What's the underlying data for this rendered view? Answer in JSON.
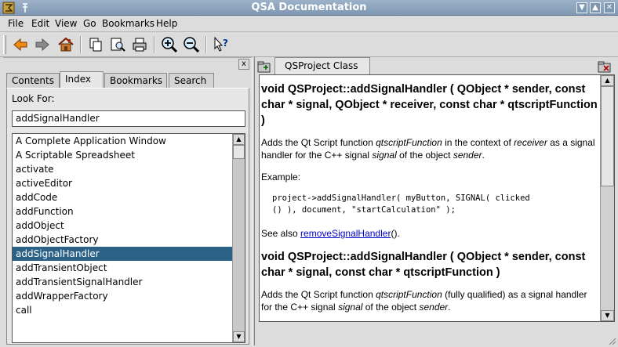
{
  "window": {
    "title": "QSA Documentation"
  },
  "menu": {
    "items": [
      "File",
      "Edit",
      "View",
      "Go",
      "Bookmarks",
      "Help"
    ]
  },
  "toolbar": {
    "buttons": [
      "back-icon",
      "forward-icon",
      "home-icon",
      "copy-icon",
      "find-icon",
      "print-icon",
      "zoom-in-icon",
      "zoom-out-icon",
      "whats-this-icon"
    ]
  },
  "sidebar": {
    "tabs": [
      "Contents",
      "Index",
      "Bookmarks",
      "Search"
    ],
    "active_tab": "Index",
    "look_for_label": "Look For:",
    "search_value": "addSignalHandler",
    "items": [
      "A Complete Application Window",
      "A Scriptable Spreadsheet",
      "activate",
      "activeEditor",
      "addCode",
      "addFunction",
      "addObject",
      "addObjectFactory",
      "addSignalHandler",
      "addTransientObject",
      "addTransientSignalHandler",
      "addWrapperFactory",
      "call"
    ],
    "selected_index": 8,
    "close_label": "x"
  },
  "document": {
    "tab_label": "QSProject Class",
    "heading1": "void QSProject::addSignalHandler ( QObject * sender, const char * signal, QObject * receiver, const char * qtscriptFunction )",
    "para1_a": "Adds the Qt Script function ",
    "para1_em1": "qtscriptFunction",
    "para1_b": " in the context of ",
    "para1_em2": "receiver",
    "para1_c": " as a signal handler for the C++ signal ",
    "para1_em3": "signal",
    "para1_d": " of the object ",
    "para1_em4": "sender",
    "para1_e": ".",
    "example_label": "Example:",
    "code": "project->addSignalHandler( myButton, SIGNAL( clicked\n() ), document, \"startCalculation\" );",
    "see_also_prefix": "See also ",
    "see_also_link": "removeSignalHandler",
    "see_also_suffix": "().",
    "heading2": "void QSProject::addSignalHandler ( QObject * sender, const char * signal, const char * qtscriptFunction )",
    "para2_a": "Adds the Qt Script function ",
    "para2_em1": "qtscriptFunction",
    "para2_b": " (fully qualified) as a signal handler for the C++ signal ",
    "para2_em2": "signal",
    "para2_c": " of the object ",
    "para2_em3": "sender",
    "para2_d": "."
  }
}
